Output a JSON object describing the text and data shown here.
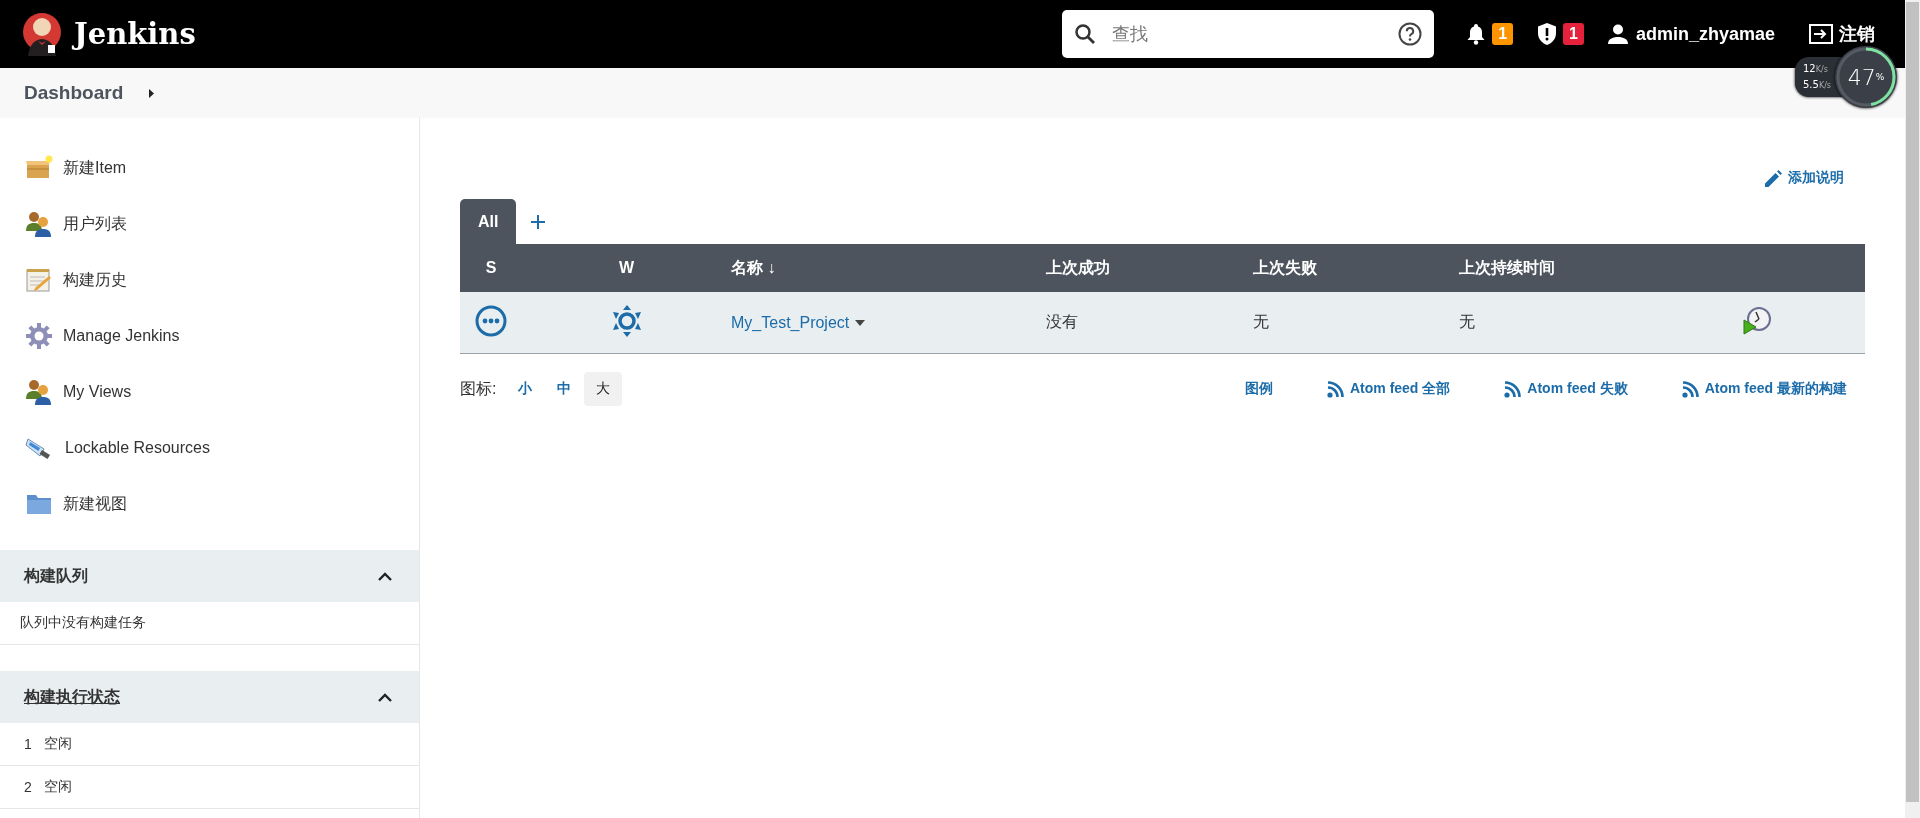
{
  "header": {
    "brand": "Jenkins",
    "search": {
      "placeholder": "查找"
    },
    "notifications": {
      "count": "1"
    },
    "security": {
      "count": "1"
    },
    "user": "admin_zhyamae",
    "logout": "注销"
  },
  "speed_widget": {
    "up": "12",
    "up_unit": "K/s",
    "down": "5.5",
    "down_unit": "K/s",
    "percent": "47",
    "percent_sign": "%",
    "level": 0.47
  },
  "breadcrumb": {
    "items": [
      "Dashboard"
    ]
  },
  "sidebar": {
    "tasks": [
      {
        "label": "新建Item"
      },
      {
        "label": "用户列表"
      },
      {
        "label": "构建历史"
      },
      {
        "label": "Manage Jenkins"
      },
      {
        "label": "My Views"
      },
      {
        "label": "Lockable Resources"
      },
      {
        "label": "新建视图"
      }
    ],
    "panes": [
      {
        "title": "构建队列",
        "kind": "plain",
        "expanded": true,
        "rows": [
          {
            "number": "",
            "text": "队列中没有构建任务"
          }
        ]
      },
      {
        "title": "构建执行状态",
        "kind": "link",
        "expanded": true,
        "rows": [
          {
            "number": "1",
            "text": "空闲"
          },
          {
            "number": "2",
            "text": "空闲"
          }
        ]
      }
    ]
  },
  "main": {
    "add_description": "添加说明",
    "tabs": [
      {
        "label": "All",
        "selected": true
      }
    ],
    "table": {
      "columns": [
        "S",
        "W",
        "名称 ↓",
        "上次成功",
        "上次失败",
        "上次持续时间"
      ],
      "rows": [
        {
          "name": "My_Test_Project",
          "last_success": "没有",
          "last_failure": "无",
          "last_duration": "无"
        }
      ]
    },
    "icon_label": "图标:",
    "icon_sizes": [
      {
        "label": "小",
        "selected": false
      },
      {
        "label": "中",
        "selected": false
      },
      {
        "label": "大",
        "selected": true
      }
    ],
    "legend": "图例",
    "feeds": [
      "Atom feed 全部",
      "Atom feed 失败",
      "Atom feed 最新的构建"
    ]
  }
}
